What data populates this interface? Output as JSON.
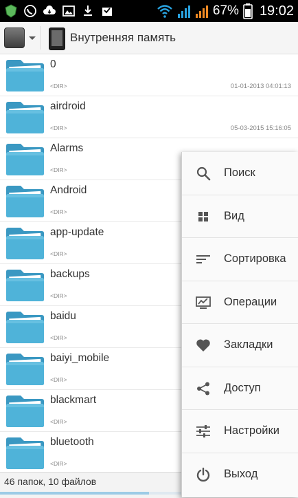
{
  "status_bar": {
    "battery": "67%",
    "time": "19:02"
  },
  "toolbar": {
    "title": "Внутренняя память"
  },
  "files": [
    {
      "name": "0",
      "type": "<DIR>",
      "date": "01-01-2013 04:01:13"
    },
    {
      "name": "airdroid",
      "type": "<DIR>",
      "date": "05-03-2015 15:16:05"
    },
    {
      "name": "Alarms",
      "type": "<DIR>",
      "date": ""
    },
    {
      "name": "Android",
      "type": "<DIR>",
      "date": ""
    },
    {
      "name": "app-update",
      "type": "<DIR>",
      "date": ""
    },
    {
      "name": "backups",
      "type": "<DIR>",
      "date": ""
    },
    {
      "name": "baidu",
      "type": "<DIR>",
      "date": ""
    },
    {
      "name": "baiyi_mobile",
      "type": "<DIR>",
      "date": ""
    },
    {
      "name": "blackmart",
      "type": "<DIR>",
      "date": ""
    },
    {
      "name": "bluetooth",
      "type": "<DIR>",
      "date": ""
    }
  ],
  "footer": {
    "summary": "46 папок, 10 файлов",
    "scroll_progress": 0.5
  },
  "menu": {
    "items": [
      {
        "label": "Поиск",
        "icon": "search-icon"
      },
      {
        "label": "Вид",
        "icon": "grid-icon"
      },
      {
        "label": "Сортировка",
        "icon": "sort-icon"
      },
      {
        "label": "Операции",
        "icon": "operations-icon"
      },
      {
        "label": "Закладки",
        "icon": "heart-icon"
      },
      {
        "label": "Доступ",
        "icon": "share-icon"
      },
      {
        "label": "Настройки",
        "icon": "settings-icon"
      },
      {
        "label": "Выход",
        "icon": "power-icon"
      }
    ]
  },
  "colors": {
    "folder": "#4fb3d9",
    "icon": "#555555",
    "wifi": "#29a3e0",
    "signal": "#f08a24"
  }
}
